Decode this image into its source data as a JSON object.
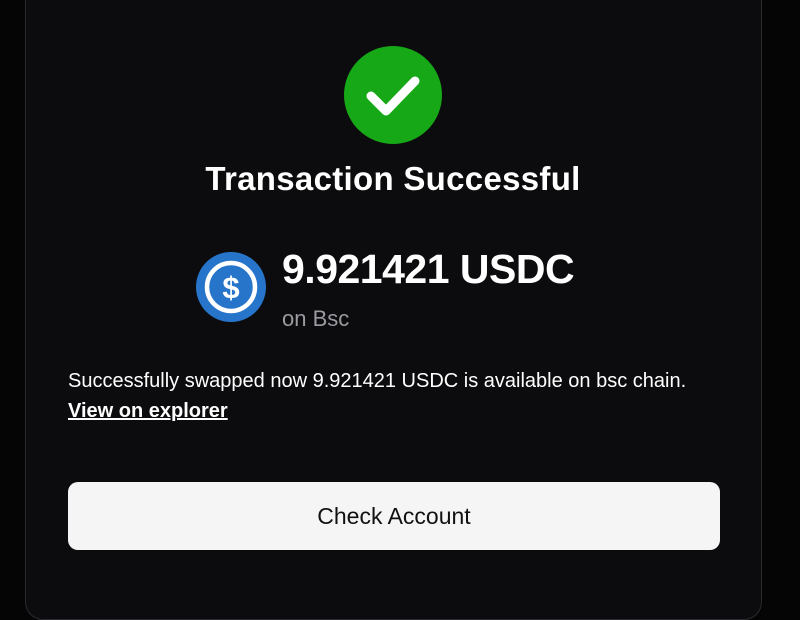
{
  "status": {
    "icon": "check-icon",
    "color": "#17a817",
    "title": "Transaction Successful"
  },
  "token": {
    "icon": "usdc-logo-icon",
    "color": "#2775ca",
    "amount_text": "9.921421 USDC",
    "network_text": "on Bsc"
  },
  "message": {
    "text": "Successfully swapped now 9.921421 USDC is available on bsc chain.",
    "link_label": "View on explorer"
  },
  "actions": {
    "check_account_label": "Check Account"
  }
}
